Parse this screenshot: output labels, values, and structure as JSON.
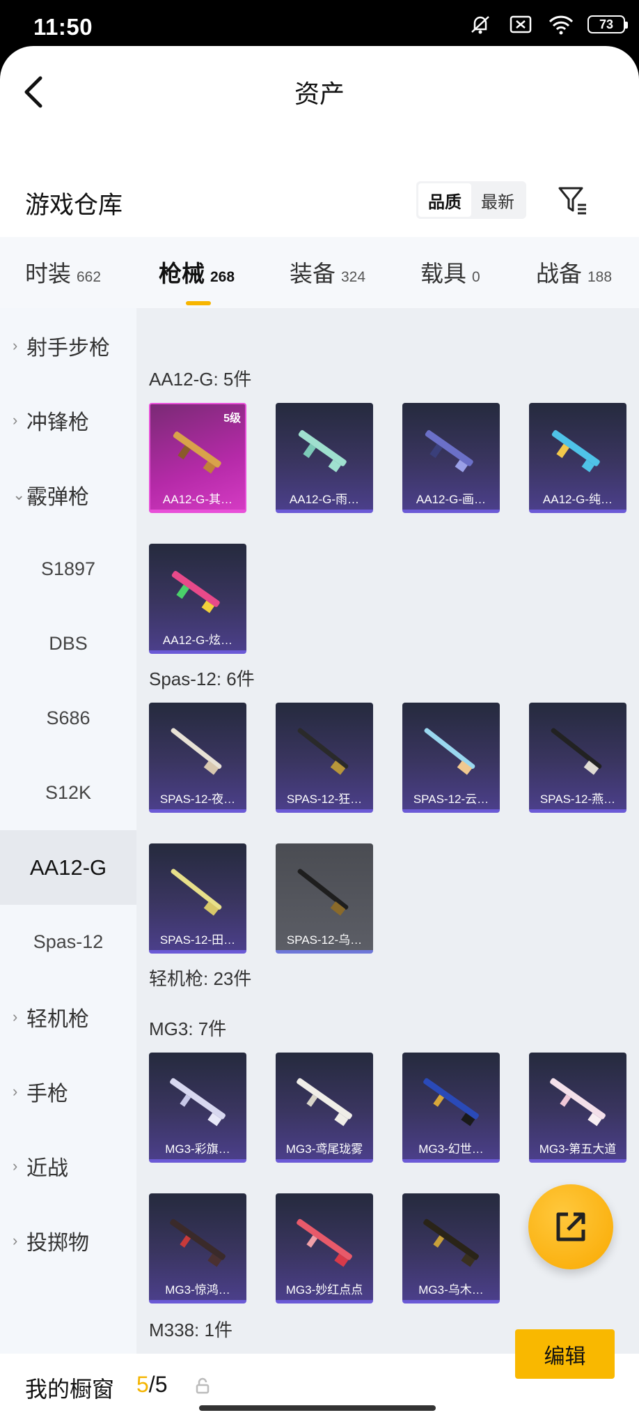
{
  "status": {
    "time": "11:50",
    "battery": "73"
  },
  "nav": {
    "title": "资产"
  },
  "warehouse": {
    "title": "游戏仓库",
    "sort_quality": "品质",
    "sort_latest": "最新"
  },
  "tabs": [
    {
      "label": "时装",
      "count": "662"
    },
    {
      "label": "枪械",
      "count": "268"
    },
    {
      "label": "装备",
      "count": "324"
    },
    {
      "label": "载具",
      "count": "0"
    },
    {
      "label": "战备",
      "count": "188"
    }
  ],
  "sidebar": [
    {
      "label": "射手步枪"
    },
    {
      "label": "冲锋枪"
    },
    {
      "label": "霰弹枪"
    },
    {
      "label": "S1897"
    },
    {
      "label": "DBS"
    },
    {
      "label": "S686"
    },
    {
      "label": "S12K"
    },
    {
      "label": "AA12-G"
    },
    {
      "label": "Spas-12"
    },
    {
      "label": "轻机枪"
    },
    {
      "label": "手枪"
    },
    {
      "label": "近战"
    },
    {
      "label": "投掷物"
    }
  ],
  "sections": {
    "aa12": {
      "title": "AA12-G: 5件",
      "items": [
        "AA12-G-其…",
        "AA12-G-雨…",
        "AA12-G-画…",
        "AA12-G-纯…",
        "AA12-G-炫…"
      ],
      "level": "5级"
    },
    "spas": {
      "title": "Spas-12: 6件",
      "items": [
        "SPAS-12-夜…",
        "SPAS-12-狂…",
        "SPAS-12-云…",
        "SPAS-12-燕…",
        "SPAS-12-田…",
        "SPAS-12-乌…"
      ]
    },
    "lmg": {
      "title": "轻机枪: 23件"
    },
    "mg3": {
      "title": "MG3: 7件",
      "items": [
        "MG3-彩旗…",
        "MG3-鸢尾珑雾",
        "MG3-幻世…",
        "MG3-第五大道",
        "MG3-惊鸿…",
        "MG3-妙红点点",
        "MG3-乌木…"
      ]
    },
    "m338": {
      "title": "M338: 1件"
    }
  },
  "bottom": {
    "label": "我的橱窗",
    "count_used": "5",
    "count_total": "/5",
    "edit": "编辑"
  }
}
